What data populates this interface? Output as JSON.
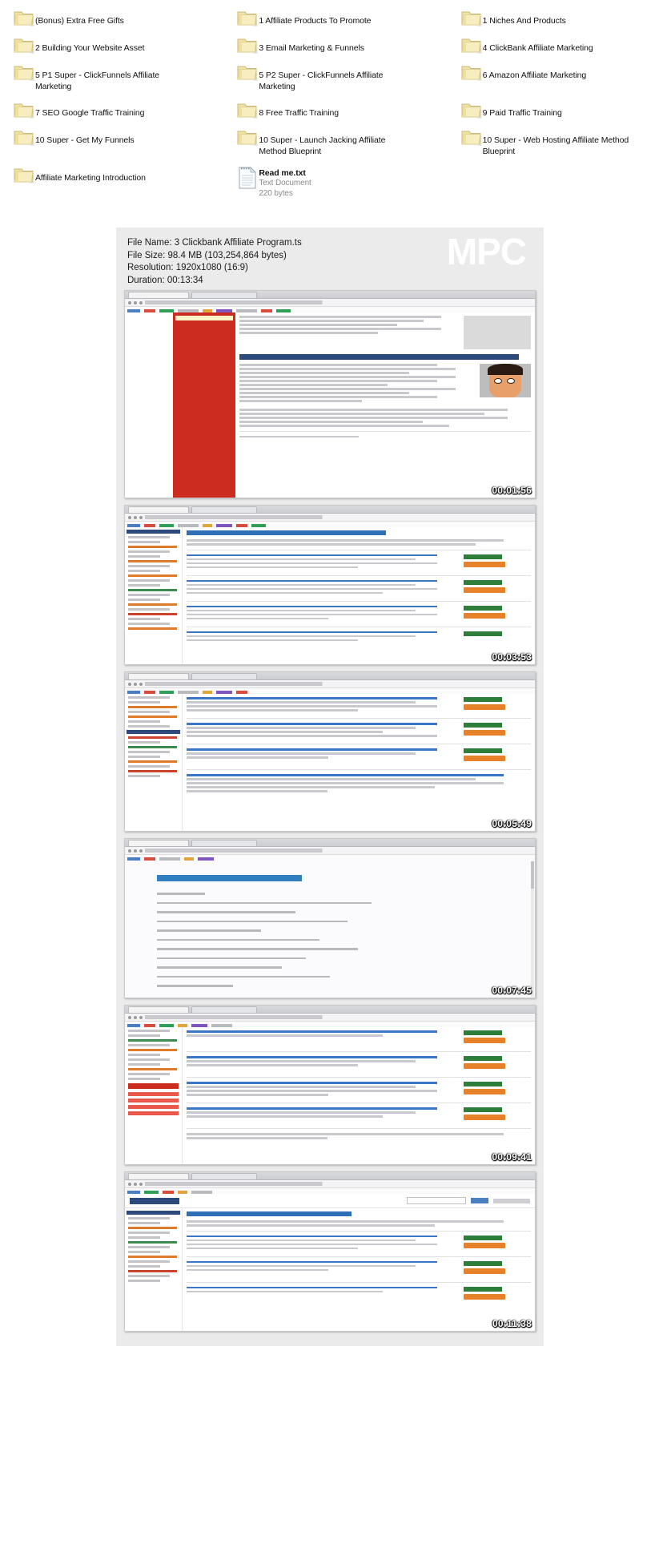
{
  "file_browser": {
    "rows": [
      [
        {
          "type": "folder",
          "name": "(Bonus) Extra Free Gifts"
        },
        {
          "type": "folder",
          "name": "1 Affiliate Products To Promote"
        },
        {
          "type": "folder",
          "name": "1 Niches And Products"
        }
      ],
      [
        {
          "type": "folder",
          "name": "2  Building Your Website Asset"
        },
        {
          "type": "folder",
          "name": "3 Email Marketing & Funnels"
        },
        {
          "type": "folder",
          "name": "4 ClickBank Affiliate Marketing"
        }
      ],
      [
        {
          "type": "folder",
          "name": "5 P1 Super - ClickFunnels Affiliate Marketing"
        },
        {
          "type": "folder",
          "name": "5 P2 Super - ClickFunnels Affiliate Marketing"
        },
        {
          "type": "folder",
          "name": "6 Amazon Affiliate Marketing"
        }
      ],
      [
        {
          "type": "folder",
          "name": "7 SEO Google Traffic Training"
        },
        {
          "type": "folder",
          "name": "8 Free Traffic Training"
        },
        {
          "type": "folder",
          "name": "9 Paid Traffic Training"
        }
      ],
      [
        {
          "type": "folder",
          "name": "10 Super - Get My Funnels"
        },
        {
          "type": "folder",
          "name": "10 Super - Launch Jacking Affiliate Method Blueprint"
        },
        {
          "type": "folder",
          "name": "10 Super - Web Hosting Affiliate Method Blueprint"
        }
      ],
      [
        {
          "type": "folder",
          "name": "Affiliate Marketing Introduction"
        },
        {
          "type": "textdoc",
          "name": "Read me.txt",
          "kind": "Text Document",
          "size": "220 bytes"
        },
        {
          "type": "empty",
          "name": ""
        }
      ]
    ]
  },
  "mpc": {
    "logo": "MPC",
    "info": {
      "file_name": "File Name: 3 Clickbank Affiliate Program.ts",
      "file_size": "File Size: 98.4 MB (103,254,864 bytes)",
      "resolution": "Resolution: 1920x1080 (16:9)",
      "duration": "Duration: 00:13:34"
    },
    "thumbnails": [
      {
        "timestamp": "00:01:56",
        "style": "red-sidebar-page"
      },
      {
        "timestamp": "00:03:53",
        "style": "marketplace-listing"
      },
      {
        "timestamp": "00:05:49",
        "style": "marketplace-listing-2"
      },
      {
        "timestamp": "00:07:45",
        "style": "text-slide"
      },
      {
        "timestamp": "00:09:41",
        "style": "marketplace-listing-3"
      },
      {
        "timestamp": "00:11:38",
        "style": "marketplace-listing-4"
      }
    ]
  },
  "colors": {
    "sheet_bg": "#ebebeb",
    "folder_body": "#f5e6a8",
    "folder_edge": "#d8c77f",
    "accent_blue": "#2f6fb5",
    "accent_orange": "#e8822a",
    "accent_red": "#cc2b20",
    "accent_green": "#2f7d3a",
    "muted_text": "#8a8a8a"
  }
}
